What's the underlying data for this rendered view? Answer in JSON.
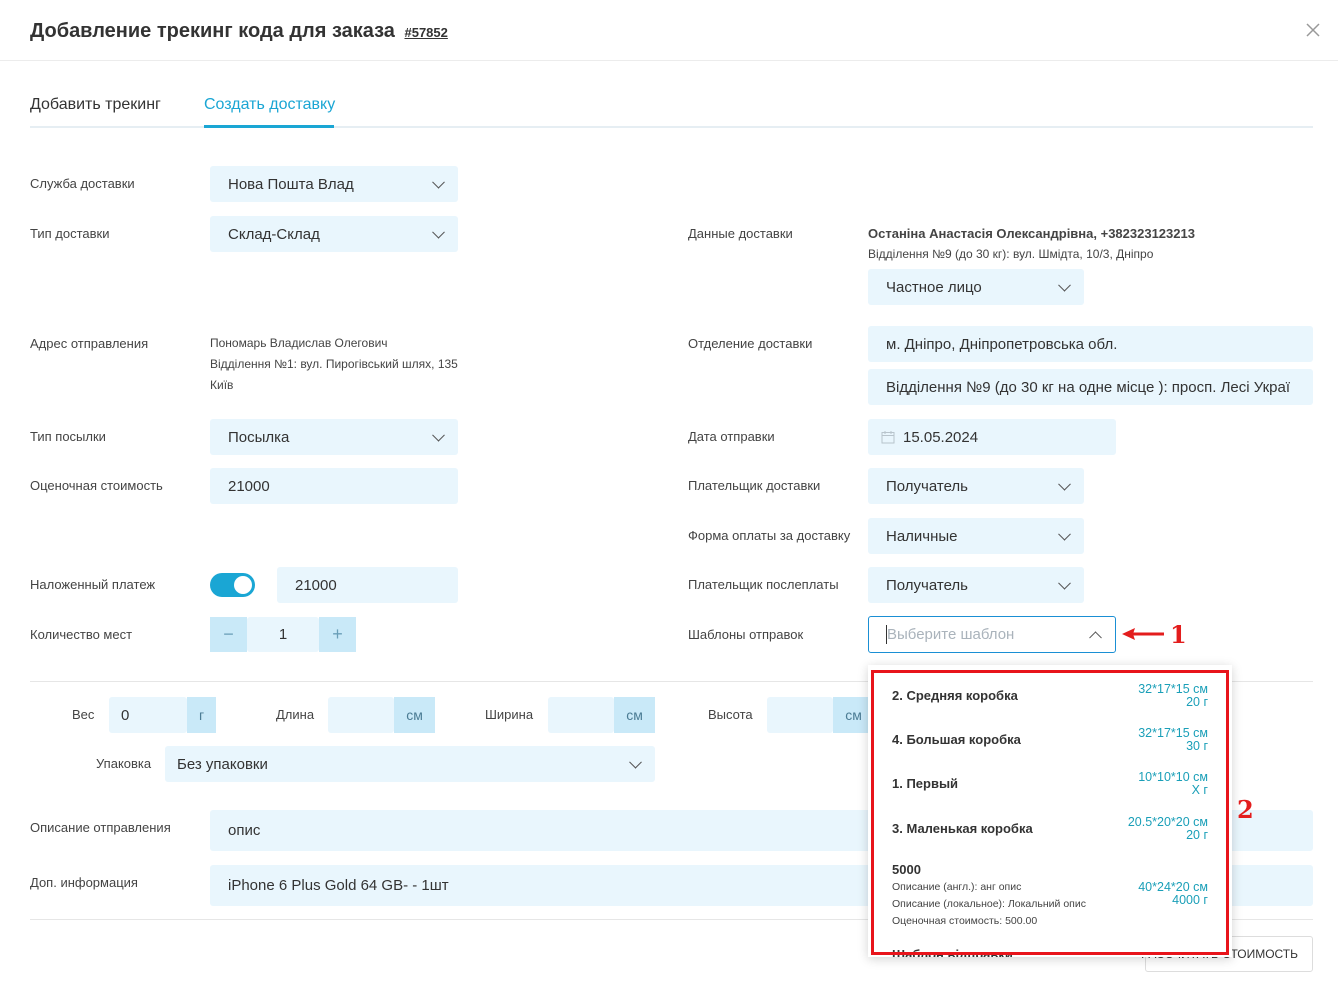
{
  "header": {
    "title": "Добавление трекинг кода для заказа",
    "order_number": "#57852"
  },
  "tabs": [
    {
      "label": "Добавить трекинг"
    },
    {
      "label": "Создать доставку"
    }
  ],
  "form": {
    "delivery_service": {
      "label": "Служба доставки",
      "value": "Нова Пошта Влад"
    },
    "delivery_type": {
      "label": "Тип доставки",
      "value": "Склад-Склад"
    },
    "sender_address": {
      "label": "Адрес отправления",
      "lines": [
        "Пономарь Владислав Олегович",
        "Відділення №1: вул. Пирогівський шлях, 135",
        "Київ"
      ]
    },
    "parcel_type": {
      "label": "Тип посылки",
      "value": "Посылка"
    },
    "estimated_value": {
      "label": "Оценочная стоимость",
      "value": "21000"
    },
    "cod": {
      "label": "Наложенный платеж",
      "value": "21000",
      "enabled": true
    },
    "places_count": {
      "label": "Количество мест",
      "value": "1",
      "minus": "−",
      "plus": "+"
    },
    "delivery_data": {
      "label": "Данные доставки",
      "recipient": "Останіна Анастасія Олександрівна, +382323123213",
      "address": "Відділення №9 (до 30 кг): вул. Шмідта, 10/3, Дніпро",
      "person_type": "Частное лицо"
    },
    "delivery_branch": {
      "label": "Отделение доставки",
      "city": "м. Дніпро, Дніпропетровська обл.",
      "branch": "Відділення №9 (до 30 кг на одне місце ): просп. Лесі Украї"
    },
    "ship_date": {
      "label": "Дата отправки",
      "value": "15.05.2024"
    },
    "delivery_payer": {
      "label": "Плательщик доставки",
      "value": "Получатель"
    },
    "payment_form": {
      "label": "Форма оплаты за доставку",
      "value": "Наличные"
    },
    "cod_payer": {
      "label": "Плательщик послеплаты",
      "value": "Получатель"
    },
    "templates": {
      "label": "Шаблоны отправок",
      "placeholder": "Выберите шаблон"
    }
  },
  "dimensions": {
    "weight": {
      "label": "Вес",
      "value": "0",
      "unit": "г"
    },
    "length": {
      "label": "Длина",
      "value": "",
      "unit": "см"
    },
    "width": {
      "label": "Ширина",
      "value": "",
      "unit": "см"
    },
    "height": {
      "label": "Высота",
      "value": "",
      "unit": "см"
    },
    "packaging": {
      "label": "Упаковка",
      "value": "Без упаковки"
    }
  },
  "description": {
    "label": "Описание отправления",
    "value": "опис"
  },
  "extra_info": {
    "label": "Доп. информация",
    "value": "iPhone 6 Plus Gold 64 GB- - 1шт"
  },
  "calc_button": "РАССЧИТАТЬ СТОИМОСТЬ",
  "template_options": [
    {
      "name": "2. Средняя коробка",
      "dims": "32*17*15 см",
      "weight": "20 г"
    },
    {
      "name": "4. Большая коробка",
      "dims": "32*17*15 см",
      "weight": "30 г"
    },
    {
      "name": "1. Первый",
      "dims": "10*10*10 см",
      "weight": "Х г"
    },
    {
      "name": "3. Маленькая коробка",
      "dims": "20.5*20*20 см",
      "weight": "20 г"
    },
    {
      "name": "5000",
      "dims": "40*24*20 см",
      "weight": "4000 г",
      "desc_en": "Описание (англ.): анг опис",
      "desc_local": "Описание (локальное): Локальний опис",
      "estimated": "Оценочная стоимость: 500.00"
    },
    {
      "name": "Шаблон відправки"
    }
  ],
  "annotations": {
    "one": "1",
    "two": "2"
  },
  "colors": {
    "accent": "#1aa6d4",
    "field_bg": "#e9f6fd",
    "annotation": "#e31d1d"
  },
  "icons": [
    "close-icon",
    "chevron-down-icon",
    "chevron-up-icon",
    "calendar-icon",
    "minus-icon",
    "plus-icon",
    "arrow-icon"
  ]
}
